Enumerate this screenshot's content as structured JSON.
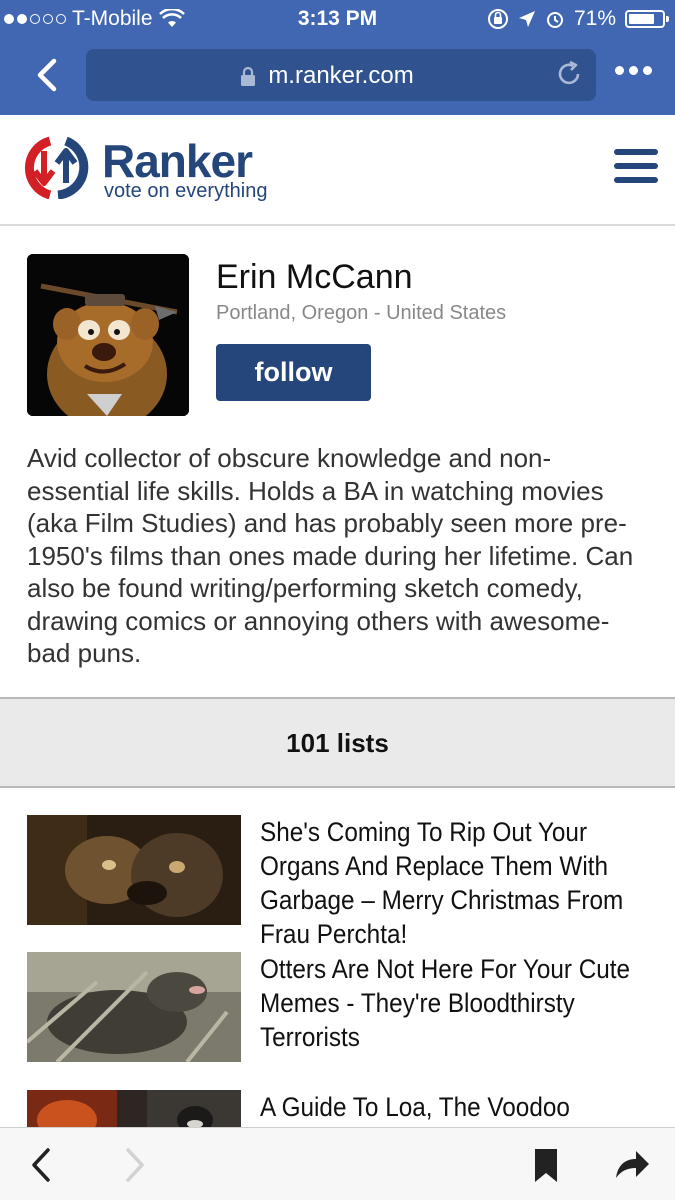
{
  "status_bar": {
    "carrier": "T-Mobile",
    "time": "3:13 PM",
    "battery": "71%",
    "signal_bars_filled": 2,
    "signal_bars_total": 5
  },
  "browser": {
    "url": "m.ranker.com",
    "icons": [
      "back-icon",
      "lock-icon",
      "reload-icon",
      "more-icon"
    ]
  },
  "site": {
    "logo_text": "Ranker",
    "tagline": "vote on everything",
    "brand_color": "#24467a"
  },
  "profile": {
    "name": "Erin McCann",
    "location": "Portland, Oregon - United States",
    "follow_label": "follow",
    "bio": "Avid collector of obscure knowledge and non-essential life skills. Holds a BA in watching movies (aka Film Studies) and has probably seen more pre-1950's films than ones made during her lifetime. Can also be found writing/performing sketch comedy, drawing comics or annoying others with awesome-bad puns."
  },
  "lists_header": "101 lists",
  "articles": [
    {
      "title": "She's Coming To Rip Out Your Organs And Replace Them With Garbage – Merry Christmas From Frau Perchta!"
    },
    {
      "title": "Otters Are Not Here For Your Cute Memes - They're Bloodthirsty Terrorists"
    },
    {
      "title": "A Guide To Loa, The Voodoo"
    }
  ],
  "toolbar": {
    "icons": [
      "back-arrow-icon",
      "forward-arrow-icon",
      "bookmark-icon",
      "share-icon"
    ]
  }
}
